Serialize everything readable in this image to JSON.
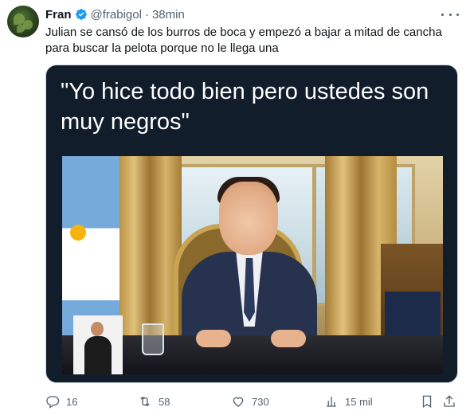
{
  "tweet": {
    "author_name": "Fran",
    "handle": "@frabigol",
    "separator": "·",
    "time": "38min",
    "text": "Julian se cansó de los burros de boca y empezó a bajar a mitad de cancha para buscar la pelota porque no le llega una"
  },
  "media": {
    "caption": "\"Yo hice todo bien pero ustedes son muy negros\""
  },
  "actions": {
    "replies": "16",
    "retweets": "58",
    "likes": "730",
    "views": "15 mil"
  },
  "icons": [
    "verified-icon",
    "more-icon",
    "reply-icon",
    "retweet-icon",
    "like-icon",
    "views-icon",
    "bookmark-icon",
    "share-icon"
  ],
  "colors": {
    "verified": "#1d9bf0",
    "secondary_text": "#536471",
    "border": "#cfd9de"
  }
}
